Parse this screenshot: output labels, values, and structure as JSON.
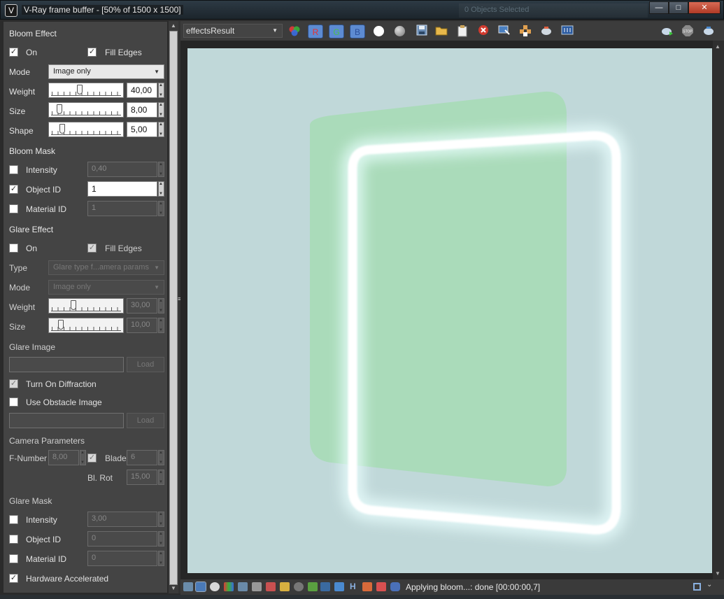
{
  "window": {
    "title": "V-Ray frame buffer - [50% of 1500 x 1500]",
    "background_hint": "0 Objects Selected",
    "minimize": "—",
    "maximize": "□",
    "close": "✕"
  },
  "bloom": {
    "header": "Bloom Effect",
    "on_label": "On",
    "on_checked": true,
    "fill_edges_label": "Fill Edges",
    "fill_edges_checked": true,
    "mode_label": "Mode",
    "mode_value": "Image only",
    "weight_label": "Weight",
    "weight_value": "40,00",
    "weight_level": 0.4,
    "size_label": "Size",
    "size_value": "8,00",
    "size_level": 0.08,
    "shape_label": "Shape",
    "shape_value": "5,00",
    "shape_level": 0.12
  },
  "bloom_mask": {
    "header": "Bloom Mask",
    "intensity_label": "Intensity",
    "intensity_value": "0,40",
    "object_id_label": "Object ID",
    "object_id_value": "1",
    "object_id_checked": true,
    "material_id_label": "Material ID",
    "material_id_value": "1"
  },
  "glare": {
    "header": "Glare Effect",
    "on_label": "On",
    "fill_edges_label": "Fill Edges",
    "type_label": "Type",
    "type_value": "Glare type f...amera params",
    "mode_label": "Mode",
    "mode_value": "Image only",
    "weight_label": "Weight",
    "weight_value": "30,00",
    "weight_level": 0.3,
    "size_label": "Size",
    "size_value": "10,00",
    "size_level": 0.1
  },
  "glare_image": {
    "header": "Glare Image",
    "load_label": "Load",
    "diffraction_label": "Turn On Diffraction",
    "obstacle_label": "Use Obstacle Image",
    "load2_label": "Load"
  },
  "camera": {
    "header": "Camera Parameters",
    "fnumber_label": "F-Number",
    "fnumber_value": "8,00",
    "blade_label": "Blade",
    "blade_value": "6",
    "blrot_label": "Bl. Rot",
    "blrot_value": "15,00"
  },
  "glare_mask": {
    "header": "Glare Mask",
    "intensity_label": "Intensity",
    "intensity_value": "3,00",
    "object_id_label": "Object ID",
    "object_id_value": "0",
    "material_id_label": "Material ID",
    "material_id_value": "0",
    "hw_label": "Hardware Accelerated",
    "hw_checked": true
  },
  "toolbar": {
    "channel": "effectsResult",
    "r": "R",
    "g": "G",
    "b": "B",
    "stop": "STOP"
  },
  "status": {
    "text": "Applying bloom...: done [00:00:00,7]",
    "h_icon": "H"
  },
  "colors": {
    "background": "#c0d8d9",
    "green_panel": "#a9dbb8",
    "glow": "#ffffff",
    "rgb_button": "#5d8bd2"
  }
}
